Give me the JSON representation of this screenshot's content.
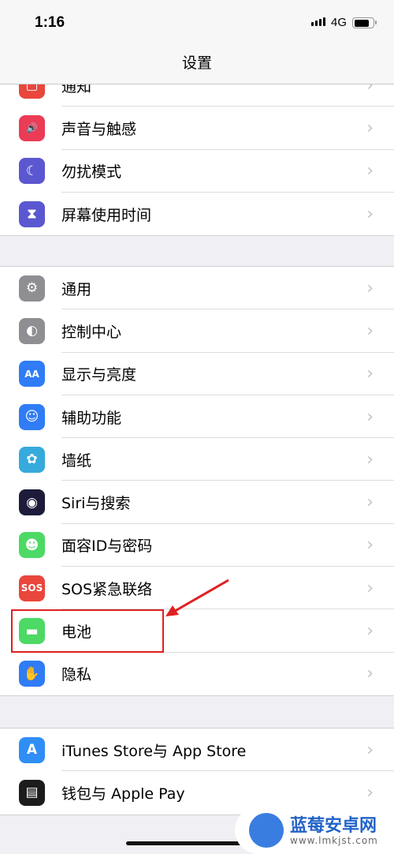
{
  "status_bar": {
    "time": "1:16",
    "network": "4G",
    "battery_level": 0.8
  },
  "nav": {
    "title": "设置"
  },
  "groups": [
    {
      "items": [
        {
          "label": "通知",
          "icon": "notifications-icon",
          "color": "#e9463c",
          "glyph": "▢"
        },
        {
          "label": "声音与触感",
          "icon": "speaker-icon",
          "color": "#ec3b55",
          "glyph": "🔊"
        },
        {
          "label": "勿扰模式",
          "icon": "moon-icon",
          "color": "#5b57d0",
          "glyph": "☾"
        },
        {
          "label": "屏幕使用时间",
          "icon": "hourglass-icon",
          "color": "#5b57d0",
          "glyph": "⧗"
        }
      ]
    },
    {
      "items": [
        {
          "label": "通用",
          "icon": "gear-icon",
          "color": "#8e8e93",
          "glyph": "⚙"
        },
        {
          "label": "控制中心",
          "icon": "toggles-icon",
          "color": "#8e8e93",
          "glyph": "◐"
        },
        {
          "label": "显示与亮度",
          "icon": "text-size-icon",
          "color": "#2f7cf6",
          "glyph": "AA"
        },
        {
          "label": "辅助功能",
          "icon": "accessibility-icon",
          "color": "#2f7cf6",
          "glyph": "☺"
        },
        {
          "label": "墙纸",
          "icon": "flower-icon",
          "color": "#36aadc",
          "glyph": "✿"
        },
        {
          "label": "Siri与搜索",
          "icon": "siri-icon",
          "color": "#1c1c3a",
          "glyph": "◉"
        },
        {
          "label": "面容ID与密码",
          "icon": "face-id-icon",
          "color": "#4cd964",
          "glyph": "☻"
        },
        {
          "label": "SOS紧急联络",
          "icon": "sos-icon",
          "color": "#e9463c",
          "glyph": "SOS"
        },
        {
          "label": "电池",
          "icon": "battery-icon",
          "color": "#4cd964",
          "glyph": "▬"
        },
        {
          "label": "隐私",
          "icon": "hand-icon",
          "color": "#2f7cf6",
          "glyph": "✋"
        }
      ]
    },
    {
      "items": [
        {
          "label": "iTunes Store与 App Store",
          "icon": "app-store-icon",
          "color": "#2f8ef6",
          "glyph": "A"
        },
        {
          "label": "钱包与 Apple Pay",
          "icon": "wallet-icon",
          "color": "#1c1c1c",
          "glyph": "▤"
        }
      ]
    }
  ],
  "watermark": {
    "name": "蓝莓安卓网",
    "url": "www.lmkjst.com"
  }
}
